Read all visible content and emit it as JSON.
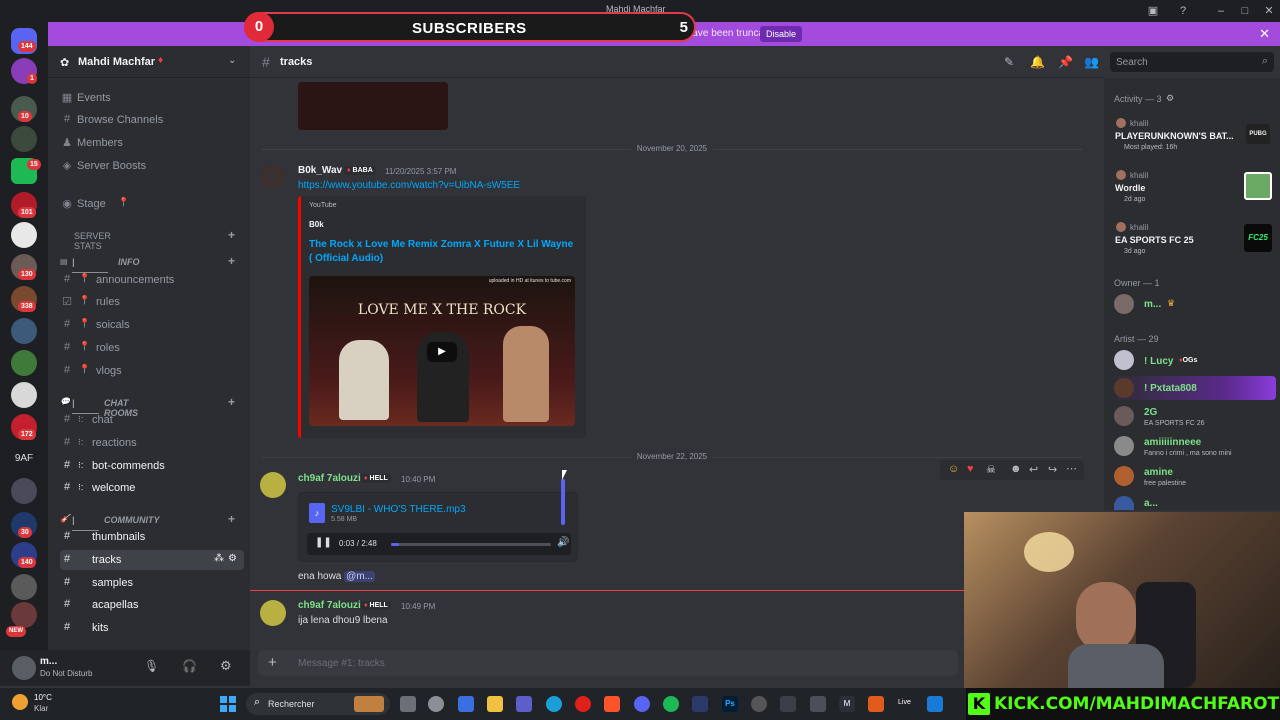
{
  "overlay": {
    "subs_left": "0",
    "subs_title": "SUBSCRIBERS",
    "subs_right": "5"
  },
  "window": {
    "title": "Mahdi Machfar"
  },
  "banner": {
    "message": "Streamer Mode is enabled. Usernames have been truncated.",
    "disable": "Disable"
  },
  "rail": {
    "badges": [
      "144",
      "1",
      "10",
      "15",
      "101",
      "130",
      "338",
      "172",
      "30",
      "140",
      "NEW"
    ],
    "text_server": "9AF"
  },
  "guild": {
    "name": "Mahdi Machfar"
  },
  "nav": {
    "events": "Events",
    "browse": "Browse Channels",
    "members": "Members",
    "boosts": "Server Boosts",
    "stage": "Stage"
  },
  "categories": {
    "stats": "SERVER STATS",
    "info": "INFO",
    "chat": "CHAT ROOMS",
    "community": "COMMUNITY"
  },
  "channels": {
    "announcements": "announcements",
    "rules": "rules",
    "socials": "soicals",
    "roles": "roles",
    "vlogs": "vlogs",
    "chat": "chat",
    "reactions": "reactions",
    "botcommands": "bot-commends",
    "welcome": "welcome",
    "thumbnails": "thumbnails",
    "tracks": "tracks",
    "samples": "samples",
    "acapellas": "acapellas",
    "kits": "kits"
  },
  "user": {
    "name": "m...",
    "status": "Do Not Disturb"
  },
  "header": {
    "channel": "tracks",
    "search_placeholder": "Search"
  },
  "messages": {
    "date1": "November 20, 2025",
    "m1": {
      "author": "B0k_Wav",
      "tag": "BABA",
      "time": "11/20/2025 3:57 PM",
      "link": "https://www.youtube.com/watch?v=UibNA-sW5EE"
    },
    "embed": {
      "provider": "YouTube",
      "author": "B0k",
      "title": "The Rock x Love Me Remix Zomra X Future X Lil Wayne ( Official Audio)",
      "thumb_text": "LOVE ME X THE ROCK",
      "thumb_corner": "uploaded in HD at itunes to tube.com"
    },
    "date2": "November 22, 2025",
    "m2": {
      "author": "ch9af 7alouzi",
      "tag": "HELL",
      "time": "10:40 PM",
      "file": "SV9LBI - WHO'S THERE.mp3",
      "size": "5.58 MB",
      "progress": "0:03 / 2:48",
      "reply_text": "ena howa",
      "mention": "@m..."
    },
    "m3": {
      "author": "ch9af 7alouzi",
      "tag": "HELL",
      "time": "10:49 PM",
      "text": "ija lena dhou9 lbena"
    }
  },
  "composer": {
    "placeholder": "Message #1:  tracks"
  },
  "memberlist": {
    "activity_head": "Activity — 3",
    "activities": [
      {
        "user": "khalil",
        "game": "PLAYERUNKNOWN'S BAT...",
        "sub": "Most played: 16h"
      },
      {
        "user": "khalil",
        "game": "Wordle",
        "sub": "2d ago"
      },
      {
        "user": "khalil",
        "game": "EA SPORTS FC 25",
        "sub": "3d ago"
      }
    ],
    "owner_head": "Owner — 1",
    "owner": "m...",
    "artist_head": "Artist — 29",
    "artists": [
      {
        "name": "! Lucy",
        "tag": "OGs",
        "sub": ""
      },
      {
        "name": "! Pxtata808",
        "tag": "",
        "sub": ""
      },
      {
        "name": "2G",
        "tag": "",
        "sub": "EA SPORTS FC 26"
      },
      {
        "name": "amiiiiinneee",
        "tag": "",
        "sub": "Fanno i crimi , ma sono mini"
      },
      {
        "name": "amine",
        "tag": "",
        "sub": "free palestine"
      },
      {
        "name": "a...",
        "tag": "",
        "sub": ""
      }
    ]
  },
  "taskbar": {
    "weather_temp": "10°C",
    "weather_desc": "Klar",
    "search": "Rechercher",
    "live": "Live"
  },
  "kick": {
    "url": "KICK.COM/MAHDIMACHFAROTB"
  }
}
